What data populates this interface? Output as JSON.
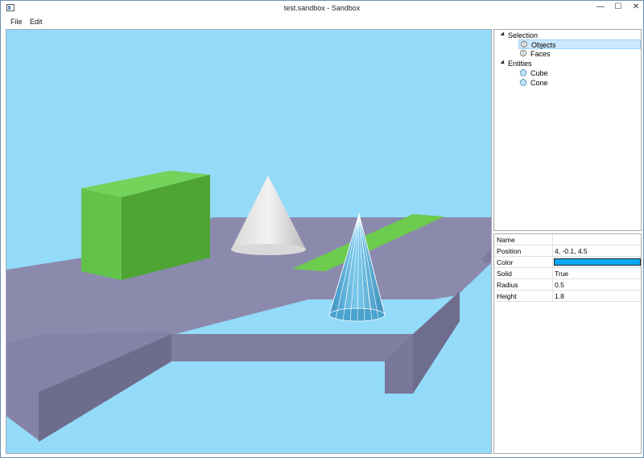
{
  "window": {
    "title": "test.sandbox - Sandbox",
    "minimize_glyph": "—",
    "maximize_glyph": "☐",
    "close_glyph": "✕"
  },
  "menu": [
    {
      "label": "File"
    },
    {
      "label": "Edit"
    }
  ],
  "tree": {
    "groups": [
      {
        "label": "Selection",
        "expanded": true,
        "children": [
          {
            "label": "Objects",
            "selected": true,
            "icon": "selection-icon"
          },
          {
            "label": "Faces",
            "selected": false,
            "icon": "selection-icon"
          }
        ]
      },
      {
        "label": "Entities",
        "expanded": true,
        "children": [
          {
            "label": "Cube",
            "selected": false,
            "icon": "entity-icon"
          },
          {
            "label": "Cone",
            "selected": false,
            "icon": "entity-icon"
          }
        ]
      }
    ]
  },
  "properties": [
    {
      "name": "Name",
      "value": ""
    },
    {
      "name": "Position",
      "value": "4, -0.1, 4.5"
    },
    {
      "name": "Color",
      "value": "",
      "swatch": "#0aa8f6"
    },
    {
      "name": "Solid",
      "value": "True"
    },
    {
      "name": "Radius",
      "value": "0.5"
    },
    {
      "name": "Height",
      "value": "1.8"
    }
  ],
  "scene": {
    "sky_color": "#94daf9",
    "ground_top_color": "#8b8aad",
    "ground_side_color": "#72708f",
    "cube_color": "#5cbb43",
    "ramp_color": "#6dcc4e",
    "cone_color": "#e6e6e6",
    "selected_cone_color": "#5bb0d6"
  }
}
